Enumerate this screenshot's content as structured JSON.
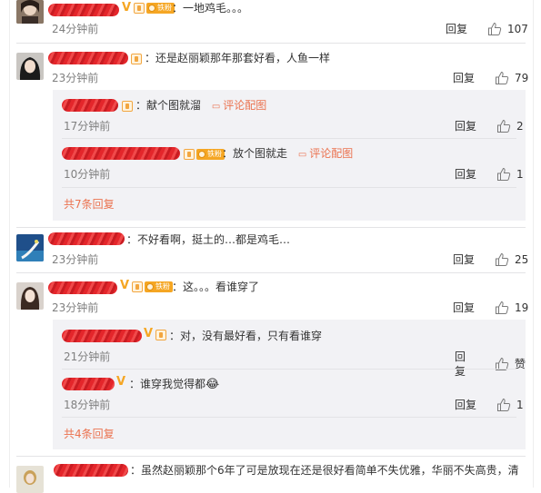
{
  "common": {
    "reply": "回复"
  },
  "comments": [
    {
      "text": "：一地鸡毛。。。",
      "time": "24分钟前",
      "likes": "107"
    },
    {
      "text": "：还是赵丽颖那年那套好看，人鱼一样",
      "time": "23分钟前",
      "likes": "79",
      "replies": [
        {
          "text": "：献个图就溜",
          "link": "评论配图",
          "time": "17分钟前",
          "likes": "2"
        },
        {
          "text": "：放个图就走",
          "link": "评论配图",
          "time": "10分钟前",
          "likes": "1"
        }
      ],
      "more": "共7条回复"
    },
    {
      "text": "：不好看啊，挺土的…都是鸡毛…",
      "time": "23分钟前",
      "likes": "25"
    },
    {
      "text": "：这。。。看谁穿了",
      "time": "23分钟前",
      "likes": "19",
      "replies": [
        {
          "text": "：对，没有最好看，只有看谁穿",
          "time": "21分钟前",
          "likes": "赞"
        },
        {
          "text": "：谁穿我觉得都",
          "emoji": "😂",
          "time": "18分钟前",
          "likes": "1"
        }
      ],
      "more": "共4条回复"
    },
    {
      "text": "：虽然赵丽颖那个6年了可是放现在还是很好看简单不失优雅，华丽不失高贵，清"
    }
  ],
  "badges": {
    "fan": "铁粉",
    "v": "V"
  }
}
